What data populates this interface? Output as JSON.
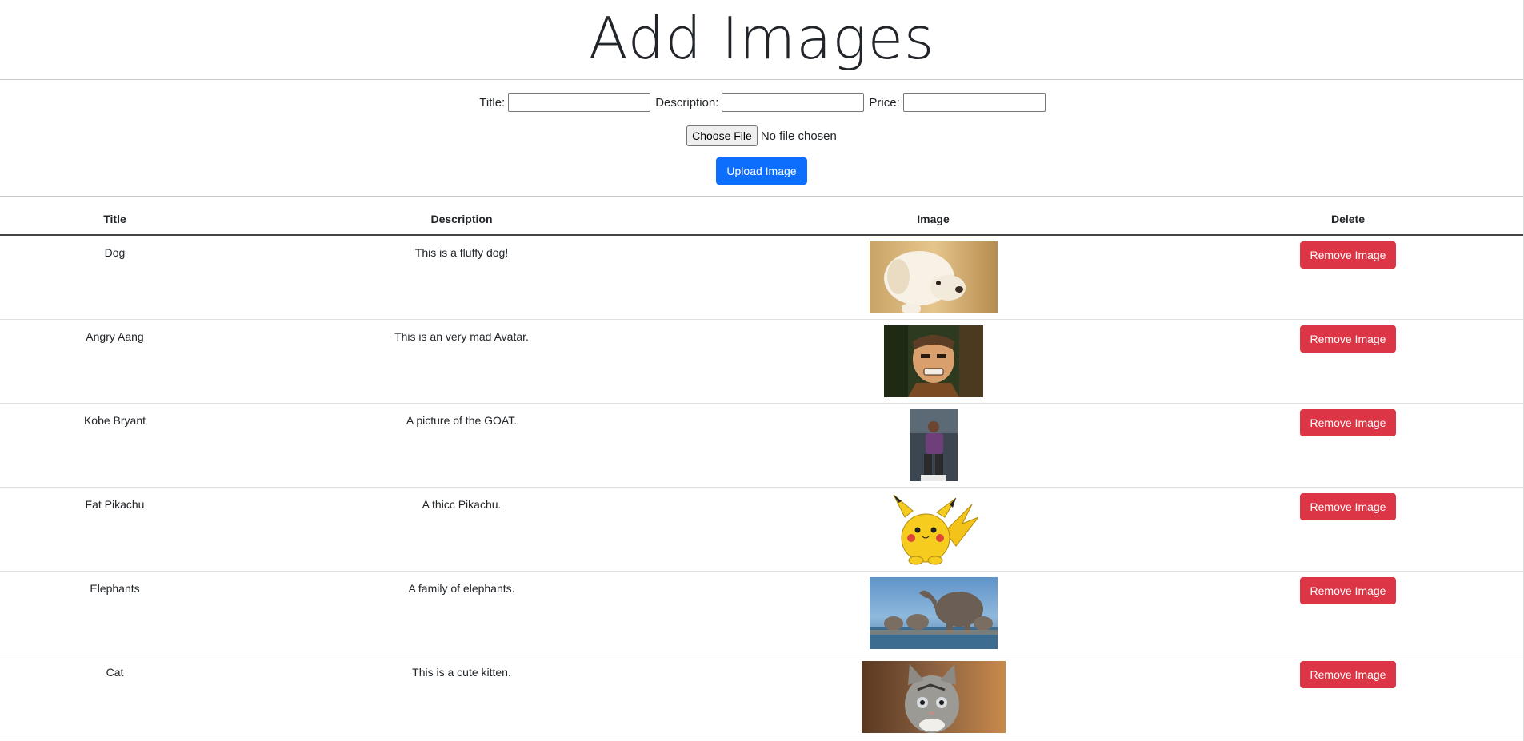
{
  "page": {
    "title": "Add Images"
  },
  "form": {
    "title_label": "Title:",
    "description_label": "Description:",
    "price_label": "Price:",
    "title_value": "",
    "description_value": "",
    "price_value": "",
    "choose_file_label": "Choose File",
    "no_file_text": "No file chosen",
    "upload_label": "Upload Image"
  },
  "table": {
    "headers": [
      "Title",
      "Description",
      "Image",
      "Delete"
    ],
    "rows": [
      {
        "title": "Dog",
        "description": "This is a fluffy dog!",
        "image": "puppy-photo",
        "delete_label": "Remove Image"
      },
      {
        "title": "Angry Aang",
        "description": "This is an very mad Avatar.",
        "image": "angry-aang-photo",
        "delete_label": "Remove Image"
      },
      {
        "title": "Kobe Bryant",
        "description": "A picture of the GOAT.",
        "image": "kobe-bryant-photo",
        "delete_label": "Remove Image"
      },
      {
        "title": "Fat Pikachu",
        "description": "A thicc Pikachu.",
        "image": "fat-pikachu-image",
        "delete_label": "Remove Image"
      },
      {
        "title": "Elephants",
        "description": "A family of elephants.",
        "image": "elephants-photo",
        "delete_label": "Remove Image"
      },
      {
        "title": "Cat",
        "description": "This is a cute kitten.",
        "image": "kitten-photo",
        "delete_label": "Remove Image"
      }
    ]
  },
  "colors": {
    "primary": "#0d6efd",
    "danger": "#dc3545",
    "text": "#212529"
  }
}
